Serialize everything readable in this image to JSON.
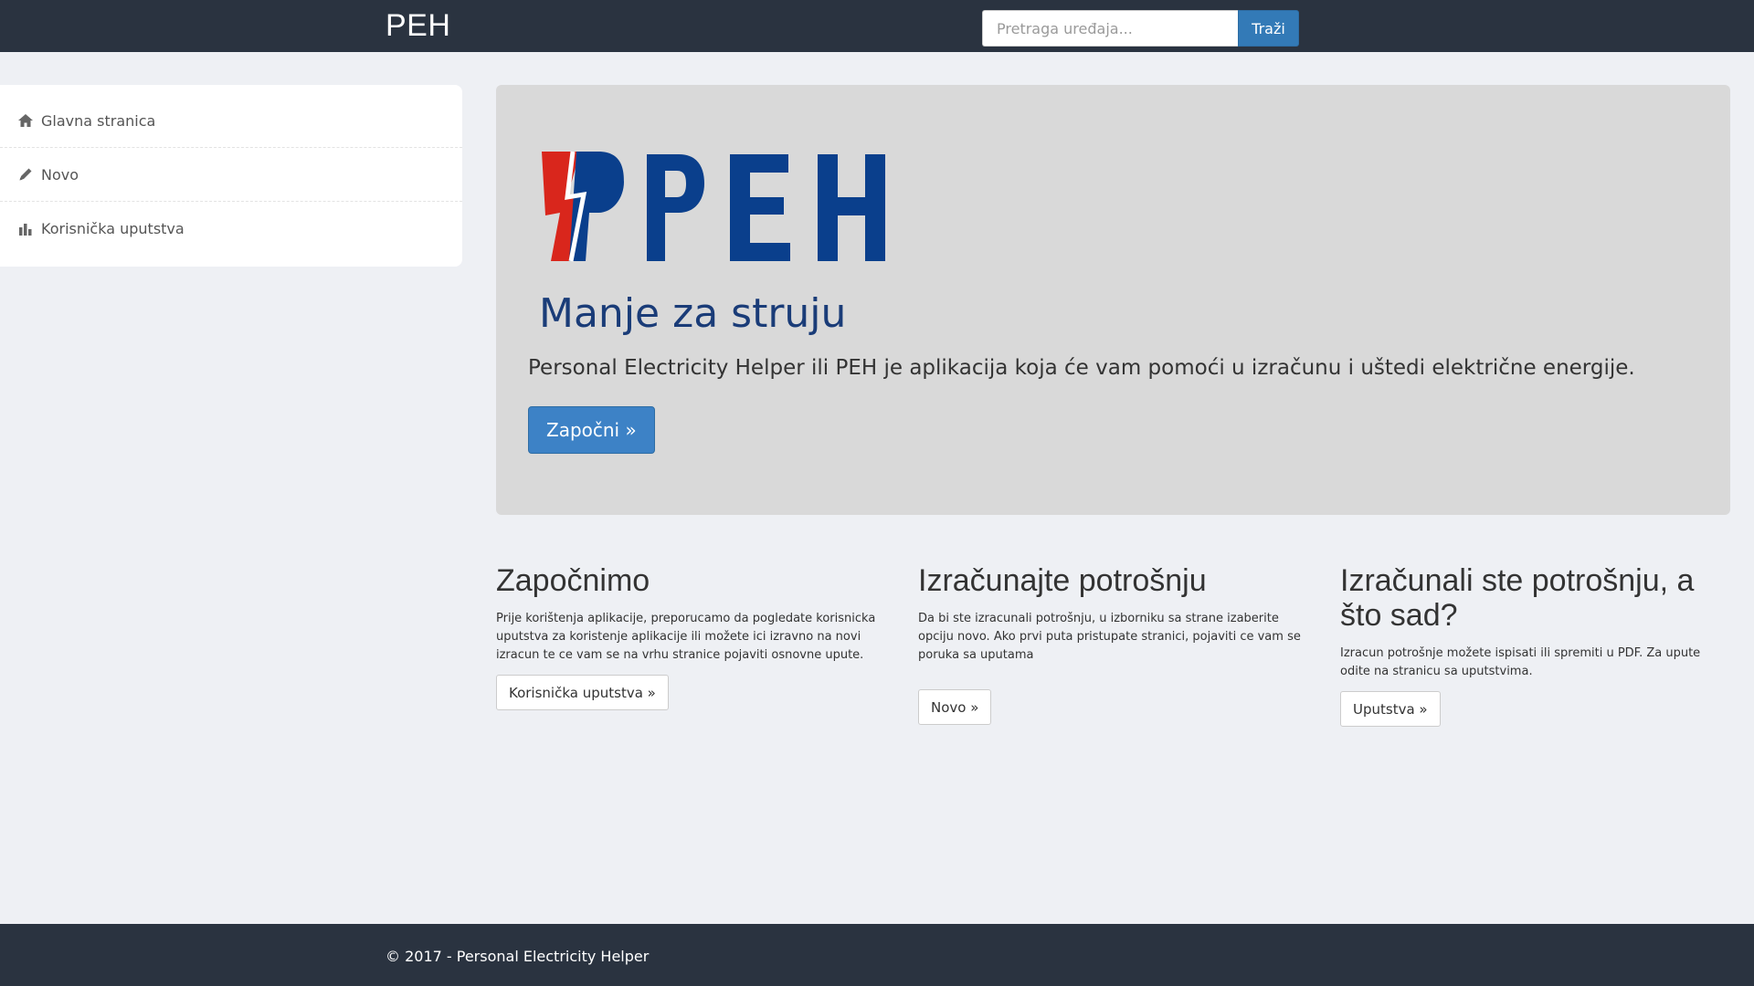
{
  "navbar": {
    "brand": "PEH",
    "search_placeholder": "Pretraga uređaja...",
    "search_button": "Traži"
  },
  "sidebar": {
    "items": [
      {
        "label": "Glavna stranica",
        "icon": "home-icon"
      },
      {
        "label": "Novo",
        "icon": "pencil-icon"
      },
      {
        "label": "Korisnička uputstva",
        "icon": "bar-chart-icon"
      }
    ]
  },
  "hero": {
    "logo_text": "PEH",
    "slogan": "Manje za struju",
    "lead": "Personal Electricity Helper ili PEH je aplikacija koja će vam pomoći u izračunu i uštedi električne energije.",
    "button": "Započni »"
  },
  "columns": [
    {
      "title": "Započnimo",
      "text": "Prije korištenja aplikacije, preporucamo da pogledate korisnicka uputstva za koristenje aplikacije ili možete ici izravno na novi izracun te ce vam se na vrhu stranice pojaviti osnovne upute.",
      "button": "Korisnička uputstva »"
    },
    {
      "title": "Izračunajte potrošnju",
      "text": "Da bi ste izracunali potrošnju, u izborniku sa strane izaberite opciju novo. Ako prvi puta pristupate stranici, pojaviti ce vam se poruka sa uputama",
      "button": "Novo »"
    },
    {
      "title": "Izračunali ste potrošnju, a što sad?",
      "text": "Izracun potrošnje možete ispisati ili spremiti u PDF. Za upute odite na stranicu sa uputstvima.",
      "button": "Uputstva »"
    }
  ],
  "footer": {
    "text": "© 2017 - Personal Electricity Helper"
  },
  "colors": {
    "navbar": "#2a3340",
    "primary": "#337ab7",
    "logo_blue": "#0a3f8c",
    "logo_red": "#d9261c",
    "slogan": "#1a3c78"
  }
}
